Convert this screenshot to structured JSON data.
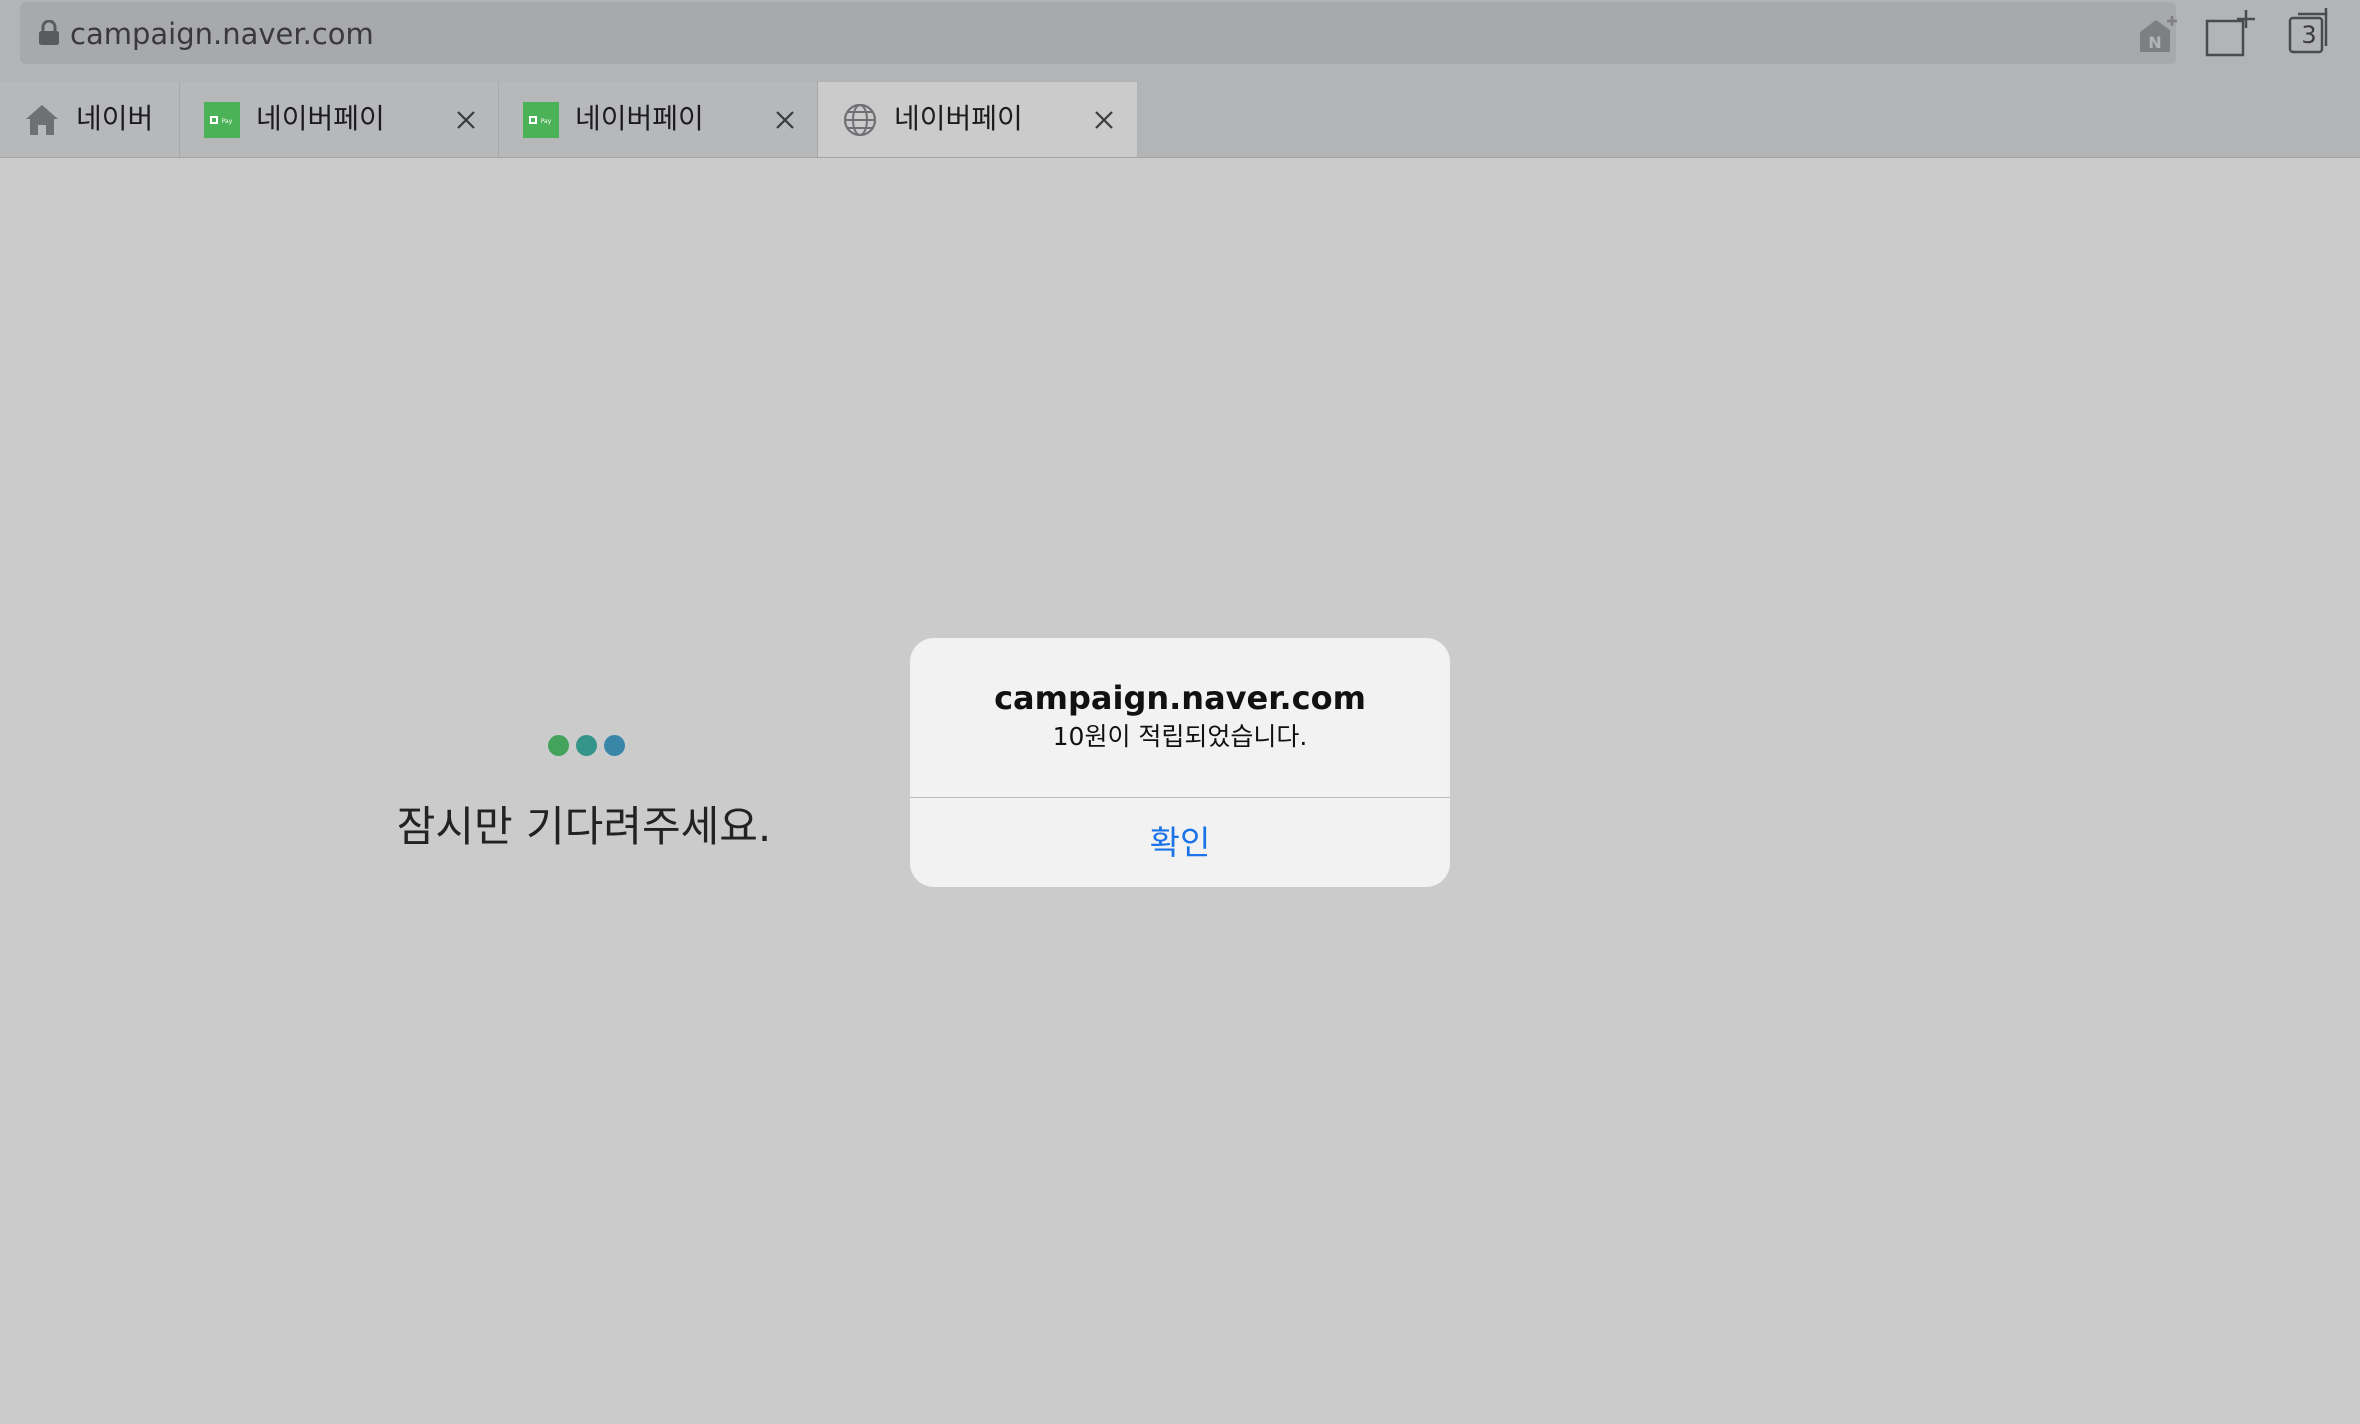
{
  "browser": {
    "url": "campaign.naver.com",
    "tab_count": "3"
  },
  "tabs": [
    {
      "label": "네이버",
      "icon": "home-icon",
      "closable": false,
      "active": false
    },
    {
      "label": "네이버페이",
      "icon": "naver-pay-favicon",
      "closable": true,
      "active": false
    },
    {
      "label": "네이버페이",
      "icon": "naver-pay-favicon",
      "closable": true,
      "active": false
    },
    {
      "label": "네이버페이",
      "icon": "globe-icon",
      "closable": true,
      "active": true
    }
  ],
  "page": {
    "loading_text": "잠시만 기다려주세요.",
    "loading_dot_colors": [
      "#43a35a",
      "#35958a",
      "#3a86a8"
    ]
  },
  "alert": {
    "title": "campaign.naver.com",
    "message": "10원이 적립되었습니다.",
    "confirm_label": "확인"
  },
  "colors": {
    "alert_button": "#1a73e8",
    "naver_green": "#4cb258"
  }
}
